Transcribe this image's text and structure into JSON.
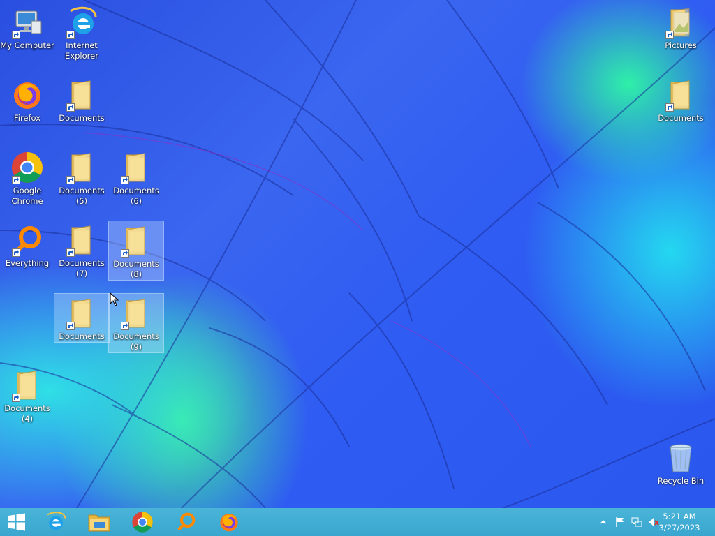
{
  "desktop_icons": [
    {
      "label": "My Computer",
      "icon": "computer-icon"
    },
    {
      "label": "Internet\nExplorer",
      "icon": "internet-explorer-icon"
    },
    {
      "label": "Firefox",
      "icon": "firefox-icon"
    },
    {
      "label": "Documents",
      "icon": "folder-icon"
    },
    {
      "label": "Google\nChrome",
      "icon": "chrome-icon"
    },
    {
      "label": "Documents\n(5)",
      "icon": "folder-icon"
    },
    {
      "label": "Documents\n(6)",
      "icon": "folder-icon"
    },
    {
      "label": "Everything",
      "icon": "everything-search-icon"
    },
    {
      "label": "Documents\n(7)",
      "icon": "folder-icon"
    },
    {
      "label": "Documents\n(8)",
      "icon": "folder-icon",
      "selected": true
    },
    {
      "label": "Documents",
      "icon": "folder-icon",
      "selected": true
    },
    {
      "label": "Documents\n(9)",
      "icon": "folder-icon",
      "selected": true
    },
    {
      "label": "Documents\n(4)",
      "icon": "folder-icon"
    },
    {
      "label": "Pictures",
      "icon": "folder-icon"
    },
    {
      "label": "Documents",
      "icon": "folder-icon"
    },
    {
      "label": "Recycle Bin",
      "icon": "recycle-bin-icon"
    }
  ],
  "taskbar": {
    "pinned": [
      "start-button",
      "internet-explorer",
      "file-explorer",
      "google-chrome",
      "everything-search",
      "firefox"
    ],
    "clock_time": "5:21 AM",
    "clock_date": "3/27/2023",
    "tray_icons": [
      "show-hidden-icons",
      "action-center-flag-icon",
      "network-icon",
      "volume-muted-icon"
    ]
  },
  "colors": {
    "accent": "#3aa6cf",
    "wallpaper_blue": "#2f5cf2",
    "wallpaper_cyan": "#24d8f0",
    "wallpaper_green": "#3df0a0"
  }
}
